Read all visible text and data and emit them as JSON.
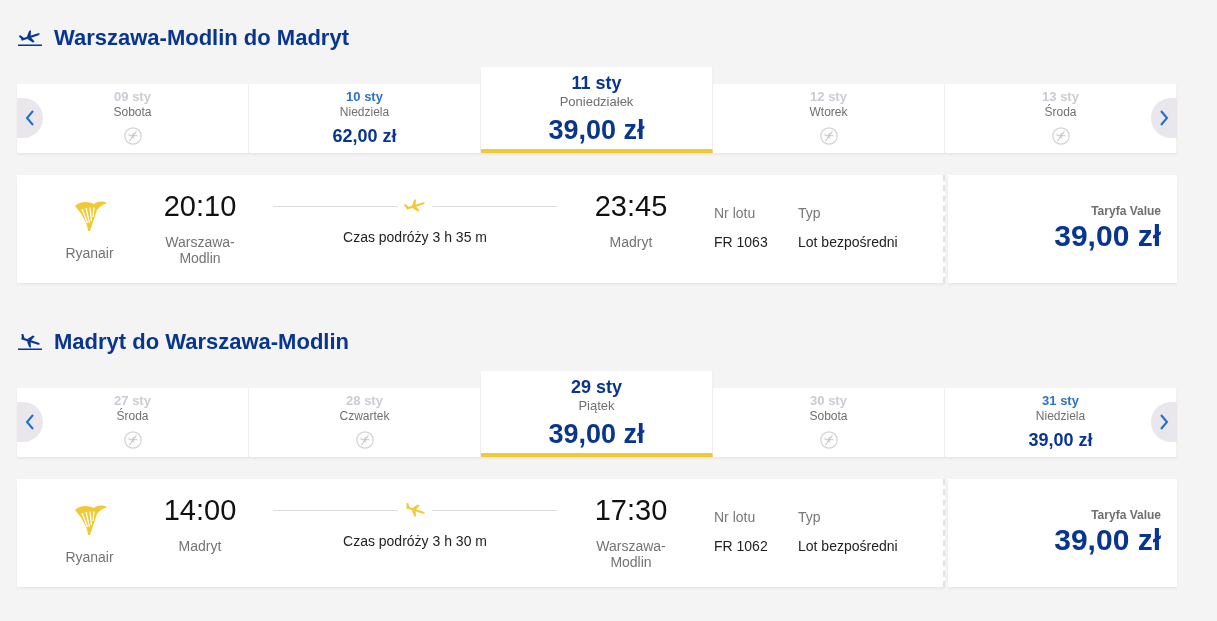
{
  "sections": [
    {
      "kind": "outbound",
      "title": "Warszawa-Modlin do Madryt",
      "dates": [
        {
          "date": "09 sty",
          "day": "Sobota",
          "available": false,
          "selected": false
        },
        {
          "date": "10 sty",
          "day": "Niedziela",
          "available": true,
          "price": "62,00 zł",
          "selected": false
        },
        {
          "date": "11 sty",
          "day": "Poniedziałek",
          "available": true,
          "price": "39,00 zł",
          "selected": true
        },
        {
          "date": "12 sty",
          "day": "Wtorek",
          "available": false,
          "selected": false
        },
        {
          "date": "13 sty",
          "day": "Środa",
          "available": false,
          "selected": false
        }
      ],
      "flight": {
        "airline": "Ryanair",
        "departure_time": "20:10",
        "departure_station": "Warszawa-Modlin",
        "duration": "Czas podróży 3 h 35 m",
        "arrival_time": "23:45",
        "arrival_station": "Madryt",
        "flight_number_label": "Nr lotu",
        "flight_number": "FR 1063",
        "type_label": "Typ",
        "type": "Lot bezpośredni",
        "fare_label": "Taryfa Value",
        "fare_price": "39,00 zł"
      }
    },
    {
      "kind": "inbound",
      "title": "Madryt do Warszawa-Modlin",
      "dates": [
        {
          "date": "27 sty",
          "day": "Środa",
          "available": false,
          "selected": false
        },
        {
          "date": "28 sty",
          "day": "Czwartek",
          "available": false,
          "selected": false
        },
        {
          "date": "29 sty",
          "day": "Piątek",
          "available": true,
          "price": "39,00 zł",
          "selected": true
        },
        {
          "date": "30 sty",
          "day": "Sobota",
          "available": false,
          "selected": false
        },
        {
          "date": "31 sty",
          "day": "Niedziela",
          "available": true,
          "price": "39,00 zł",
          "selected": false
        }
      ],
      "flight": {
        "airline": "Ryanair",
        "departure_time": "14:00",
        "departure_station": "Madryt",
        "duration": "Czas podróży 3 h 30 m",
        "arrival_time": "17:30",
        "arrival_station": "Warszawa-Modlin",
        "flight_number_label": "Nr lotu",
        "flight_number": "FR 1062",
        "type_label": "Typ",
        "type": "Lot bezpośredni",
        "fare_label": "Taryfa Value",
        "fare_price": "39,00 zł"
      }
    }
  ]
}
